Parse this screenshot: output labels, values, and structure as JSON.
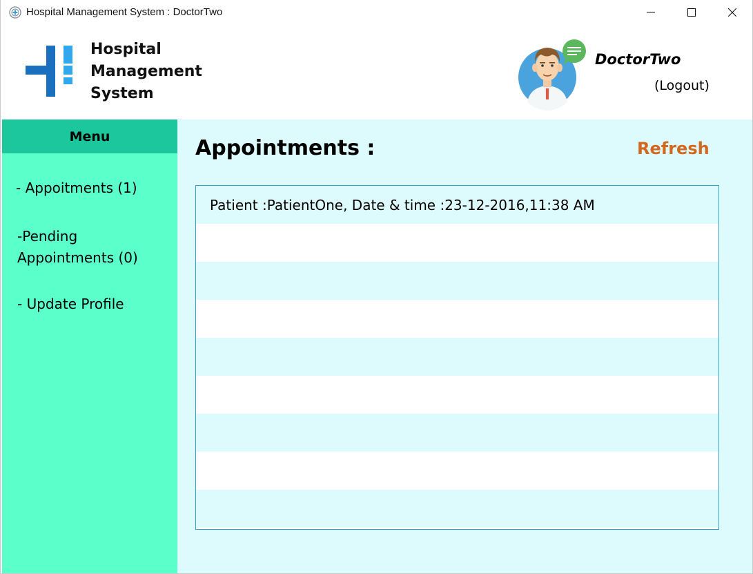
{
  "window": {
    "title": "Hospital Management System : DoctorTwo"
  },
  "header": {
    "brand_line1": "Hospital",
    "brand_line2": "Management",
    "brand_line3": "System",
    "doctor_name": "DoctorTwo",
    "logout_label": "(Logout)"
  },
  "sidebar": {
    "menu_title": "Menu",
    "items": [
      {
        "label": "- Appoitments (1)"
      },
      {
        "label": "-Pending Appointments (0)"
      },
      {
        "label": "- Update Profile"
      }
    ]
  },
  "main": {
    "title": "Appointments :",
    "refresh_label": "Refresh",
    "appointments": [
      {
        "text": "Patient :PatientOne, Date & time :23-12-2016,11:38 AM"
      },
      {
        "text": ""
      },
      {
        "text": ""
      },
      {
        "text": ""
      },
      {
        "text": ""
      },
      {
        "text": ""
      },
      {
        "text": ""
      },
      {
        "text": ""
      },
      {
        "text": ""
      }
    ]
  },
  "colors": {
    "sidebar_bg": "#5bffc9",
    "menu_header_bg": "#1dc79e",
    "main_bg": "#ddfafc",
    "refresh": "#d2691e",
    "list_border": "#3aa0d0"
  }
}
